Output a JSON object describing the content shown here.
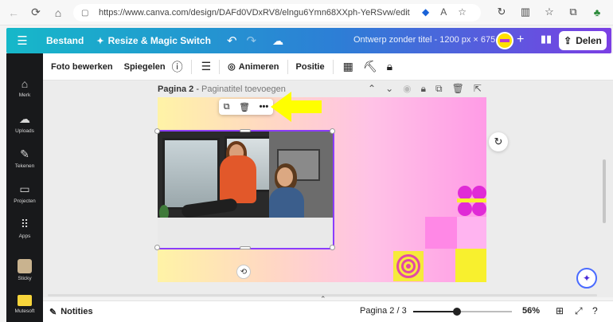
{
  "browser": {
    "url": "https://www.canva.com/design/DAFd0VDxRV8/elngu6Ymn68XXph-YeRSvw/edit"
  },
  "header": {
    "menu_icon": "hamburger-icon",
    "file_label": "Bestand",
    "resize_label": "Resize & Magic Switch",
    "title": "Ontwerp zonder titel - 1200 px × 675 px",
    "share_label": "Delen"
  },
  "sidebar": {
    "items": [
      {
        "label": "Merk",
        "icon": "brand-icon"
      },
      {
        "label": "Uploads",
        "icon": "upload-icon"
      },
      {
        "label": "Tekenen",
        "icon": "draw-icon"
      },
      {
        "label": "Projecten",
        "icon": "folder-icon"
      },
      {
        "label": "Apps",
        "icon": "apps-icon"
      },
      {
        "label": "Sticky",
        "icon": "sticky-icon"
      },
      {
        "label": "Mutesoft",
        "icon": "mutesoft-icon"
      }
    ]
  },
  "context_toolbar": {
    "edit_photo": "Foto bewerken",
    "flip": "Spiegelen",
    "animate": "Animeren",
    "position": "Positie"
  },
  "page": {
    "label": "Pagina 2",
    "title_placeholder": "Paginatitel toevoegen"
  },
  "bottom": {
    "notes_label": "Notities",
    "page_count": "Pagina 2 / 3",
    "zoom": "56%",
    "zoom_fraction": 0.44
  },
  "colors": {
    "selection": "#8b3dff",
    "arrow": "#ffff00",
    "deco_pink": "#e24aa5",
    "deco_yellow": "#f8f02e"
  }
}
